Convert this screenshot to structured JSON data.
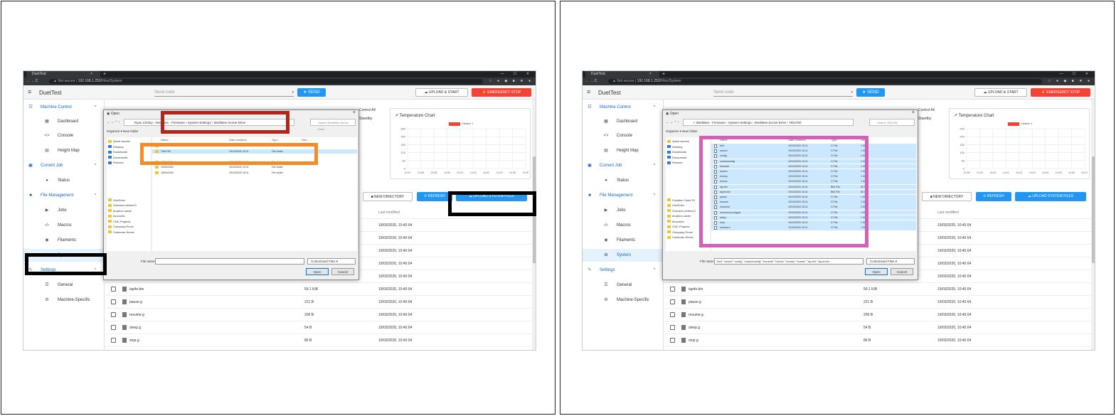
{
  "browser": {
    "tab_title": "DuetTest",
    "tab_close": "×",
    "new_tab": "+",
    "window_controls": "—  ☐  ✕",
    "nav_icons": "←  →  C",
    "security": "▲ Not secure",
    "url_host": "192.168.1.253",
    "url_path": "/Files/System",
    "ext_icons": "☆ ● ◆ ■ ★ ●"
  },
  "app": {
    "title": "DuetTest",
    "send_code_placeholder": "Send code",
    "send_label": "SEND",
    "upload_start_label": "UPLOAD & START",
    "emergency_stop_label": "EMERGENCY STOP",
    "control_all": "Control All",
    "standby": "Standby"
  },
  "sidebar": {
    "sections": [
      {
        "label": "Machine Control",
        "items": [
          "Dashboard",
          "Console",
          "Height Map"
        ]
      },
      {
        "label": "Current Job",
        "items": [
          "Status"
        ]
      },
      {
        "label": "File Management",
        "items": [
          "Jobs",
          "Macros",
          "Filaments",
          "System"
        ]
      },
      {
        "label": "Settings",
        "items": [
          "General",
          "Machine-Specific"
        ]
      }
    ]
  },
  "chart": {
    "title": "Temperature Chart",
    "legend": "Heater 1",
    "y_ticks": [
      "250",
      "200",
      "150",
      "100",
      "50",
      "0"
    ],
    "x_ticks": [
      "13:57",
      "13:58",
      "13:59",
      "14:00",
      "14:01",
      "14:02",
      "14:03",
      "14:04",
      "14:05",
      "14:06"
    ]
  },
  "chart_right": {
    "x_ticks": [
      "12:58",
      "13:59",
      "14:00",
      "14:01",
      "14:02",
      "14:03",
      "14:04",
      "14:05",
      "14:06",
      "14:07"
    ]
  },
  "actions": {
    "new_directory": "NEW DIRECTORY",
    "refresh": "REFRESH",
    "upload_system_files": "UPLOAD SYSTEM FILES"
  },
  "table": {
    "last_modified_header": "Last modified",
    "rows": [
      {
        "name": "",
        "size": "",
        "date": "19/03/2020, 10:40:04"
      },
      {
        "name": "",
        "size": "",
        "date": "19/03/2020, 10:40:04"
      },
      {
        "name": "",
        "size": "",
        "date": "19/03/2020, 10:40:04"
      },
      {
        "name": "",
        "size": "",
        "date": "19/03/2020, 10:40:04"
      },
      {
        "name": "homedelta.g",
        "size": "743 B",
        "date": "19/03/2020, 10:40:04"
      },
      {
        "name": "iap4e.bin",
        "size": "59.1 KiB",
        "date": "19/03/2020, 10:40:04"
      },
      {
        "name": "pause.g",
        "size": "221 B",
        "date": "19/03/2020, 10:40:04"
      },
      {
        "name": "resume.g",
        "size": "206 B",
        "date": "19/03/2020, 10:40:04"
      },
      {
        "name": "sleep.g",
        "size": "54 B",
        "date": "19/03/2020, 10:40:04"
      },
      {
        "name": "stop.g",
        "size": "86 B",
        "date": "19/03/2020, 10:40:04"
      }
    ]
  },
  "dialog_left": {
    "title": "Open",
    "breadcrumb": "Ryan Christy  ›  WorkBee - Firmware  ›  System-Settings  ›  WorkBee-Screw-Drive",
    "search_placeholder": "Search WorkBee-Screw-Drive",
    "organize": "Organize ▾",
    "new_folder": "New folder",
    "col_name": "Name",
    "col_date": "Date modified",
    "col_type": "Type",
    "col_size": "Size",
    "nav_tree": [
      "Quick access",
      "Desktop",
      "Downloads",
      "Documents",
      "Pictures",
      "",
      "",
      "",
      "",
      "",
      "",
      "OneDrive",
      "Ooznest Limited D",
      "dropbox.cache",
      "Accounts",
      "CNC-Projects",
      "Company-Proce",
      "Customer-Servic"
    ],
    "files": [
      {
        "name": "500x500",
        "date": "19/10/2020 15:11",
        "type": "File folder"
      },
      {
        "name": "750x750",
        "date": "19/10/2020 15:11",
        "type": "File folder"
      },
      {
        "name": "",
        "date": "",
        "type": ""
      },
      {
        "name": "1000x1000",
        "date": "19/10/2020 15:11",
        "type": "File folder"
      },
      {
        "name": "1000x1500",
        "date": "19/10/2020 15:11",
        "type": "File folder"
      },
      {
        "name": "1500x1500",
        "date": "19/10/2020 15:11",
        "type": "File folder"
      }
    ],
    "file_name_label": "File name:",
    "file_name_value": "",
    "file_type": "Customised Files",
    "open_label": "Open",
    "cancel_label": "Cancel"
  },
  "dialog_right": {
    "title": "Open",
    "breadcrumb": "«  WorkBee - Firmware  ›  System-Settings  ›  WorkBee-Screw-Drive  ›  750x750",
    "search_placeholder": "Search 750x750",
    "organize": "Organize ▾",
    "new_folder": "New folder",
    "col_name": "Name",
    "col_date": "Date modified",
    "col_type": "Type",
    "col_size": "Size",
    "nav_tree": [
      "Quick access",
      "Desktop",
      "Downloads",
      "Documents",
      "Pictures",
      "",
      "",
      "",
      "",
      "",
      "",
      "Creative Cloud Fil",
      "OneDrive",
      "Ooznest Limited D",
      "dropbox.cache",
      "Accounts",
      "CNC-Projects",
      "Company-Proce",
      "Customer-Servic"
    ],
    "files": [
      {
        "name": "bed",
        "date": "19/10/2020 15:11",
        "type": "G File",
        "size": "1 KB"
      },
      {
        "name": "cancel",
        "date": "19/10/2020 15:11",
        "type": "G File",
        "size": "1 KB"
      },
      {
        "name": "config",
        "date": "19/10/2020 15:11",
        "type": "G File",
        "size": "2 KB"
      },
      {
        "name": "customconfig",
        "date": "19/10/2020 15:11",
        "type": "G File",
        "size": "1 KB"
      },
      {
        "name": "homeall",
        "date": "19/10/2020 15:11",
        "type": "G File",
        "size": "1 KB"
      },
      {
        "name": "homex",
        "date": "19/10/2020 15:11",
        "type": "G File",
        "size": "1 KB"
      },
      {
        "name": "homey",
        "date": "19/10/2020 15:11",
        "type": "G File",
        "size": "1 KB"
      },
      {
        "name": "homez",
        "date": "19/10/2020 15:11",
        "type": "G File",
        "size": "1 KB"
      },
      {
        "name": "iap.bin",
        "date": "19/10/2020 15:11",
        "type": "BIN File",
        "size": "60 KB"
      },
      {
        "name": "iap4e.bin",
        "date": "19/10/2020 15:11",
        "type": "BIN File",
        "size": "60 KB"
      },
      {
        "name": "pause",
        "date": "19/10/2020 15:11",
        "type": "G File",
        "size": "1 KB"
      },
      {
        "name": "resume",
        "date": "19/10/2020 15:11",
        "type": "G File",
        "size": "1 KB"
      },
      {
        "name": "resurrect",
        "date": "19/10/2020 15:11",
        "type": "G File",
        "size": "0 KB"
      },
      {
        "name": "resurrect-prologue",
        "date": "19/10/2020 15:11",
        "type": "G File",
        "size": "1 KB"
      },
      {
        "name": "sleep",
        "date": "19/10/2020 15:11",
        "type": "G File",
        "size": "1 KB"
      },
      {
        "name": "stop",
        "date": "19/10/2020 15:11",
        "type": "G File",
        "size": "1 KB"
      },
      {
        "name": "workzero",
        "date": "19/10/2020 15:11",
        "type": "G File",
        "size": "1 KB"
      }
    ],
    "file_name_label": "File name:",
    "file_name_value": "\"bed\" \"cancel\" \"config\" \"customconfig\" \"homeall\" \"homex\" \"homey\" \"homez\" \"iap.bin\" \"iap4e.bin\"",
    "file_type": "Customised Files",
    "open_label": "Open",
    "cancel_label": "Cancel"
  },
  "colors": {
    "primary": "#2196f3",
    "danger": "#f44336",
    "highlight_black": "#000000",
    "highlight_red": "#b0261b",
    "highlight_orange": "#f28c28",
    "highlight_magenta": "#d35fb7"
  }
}
